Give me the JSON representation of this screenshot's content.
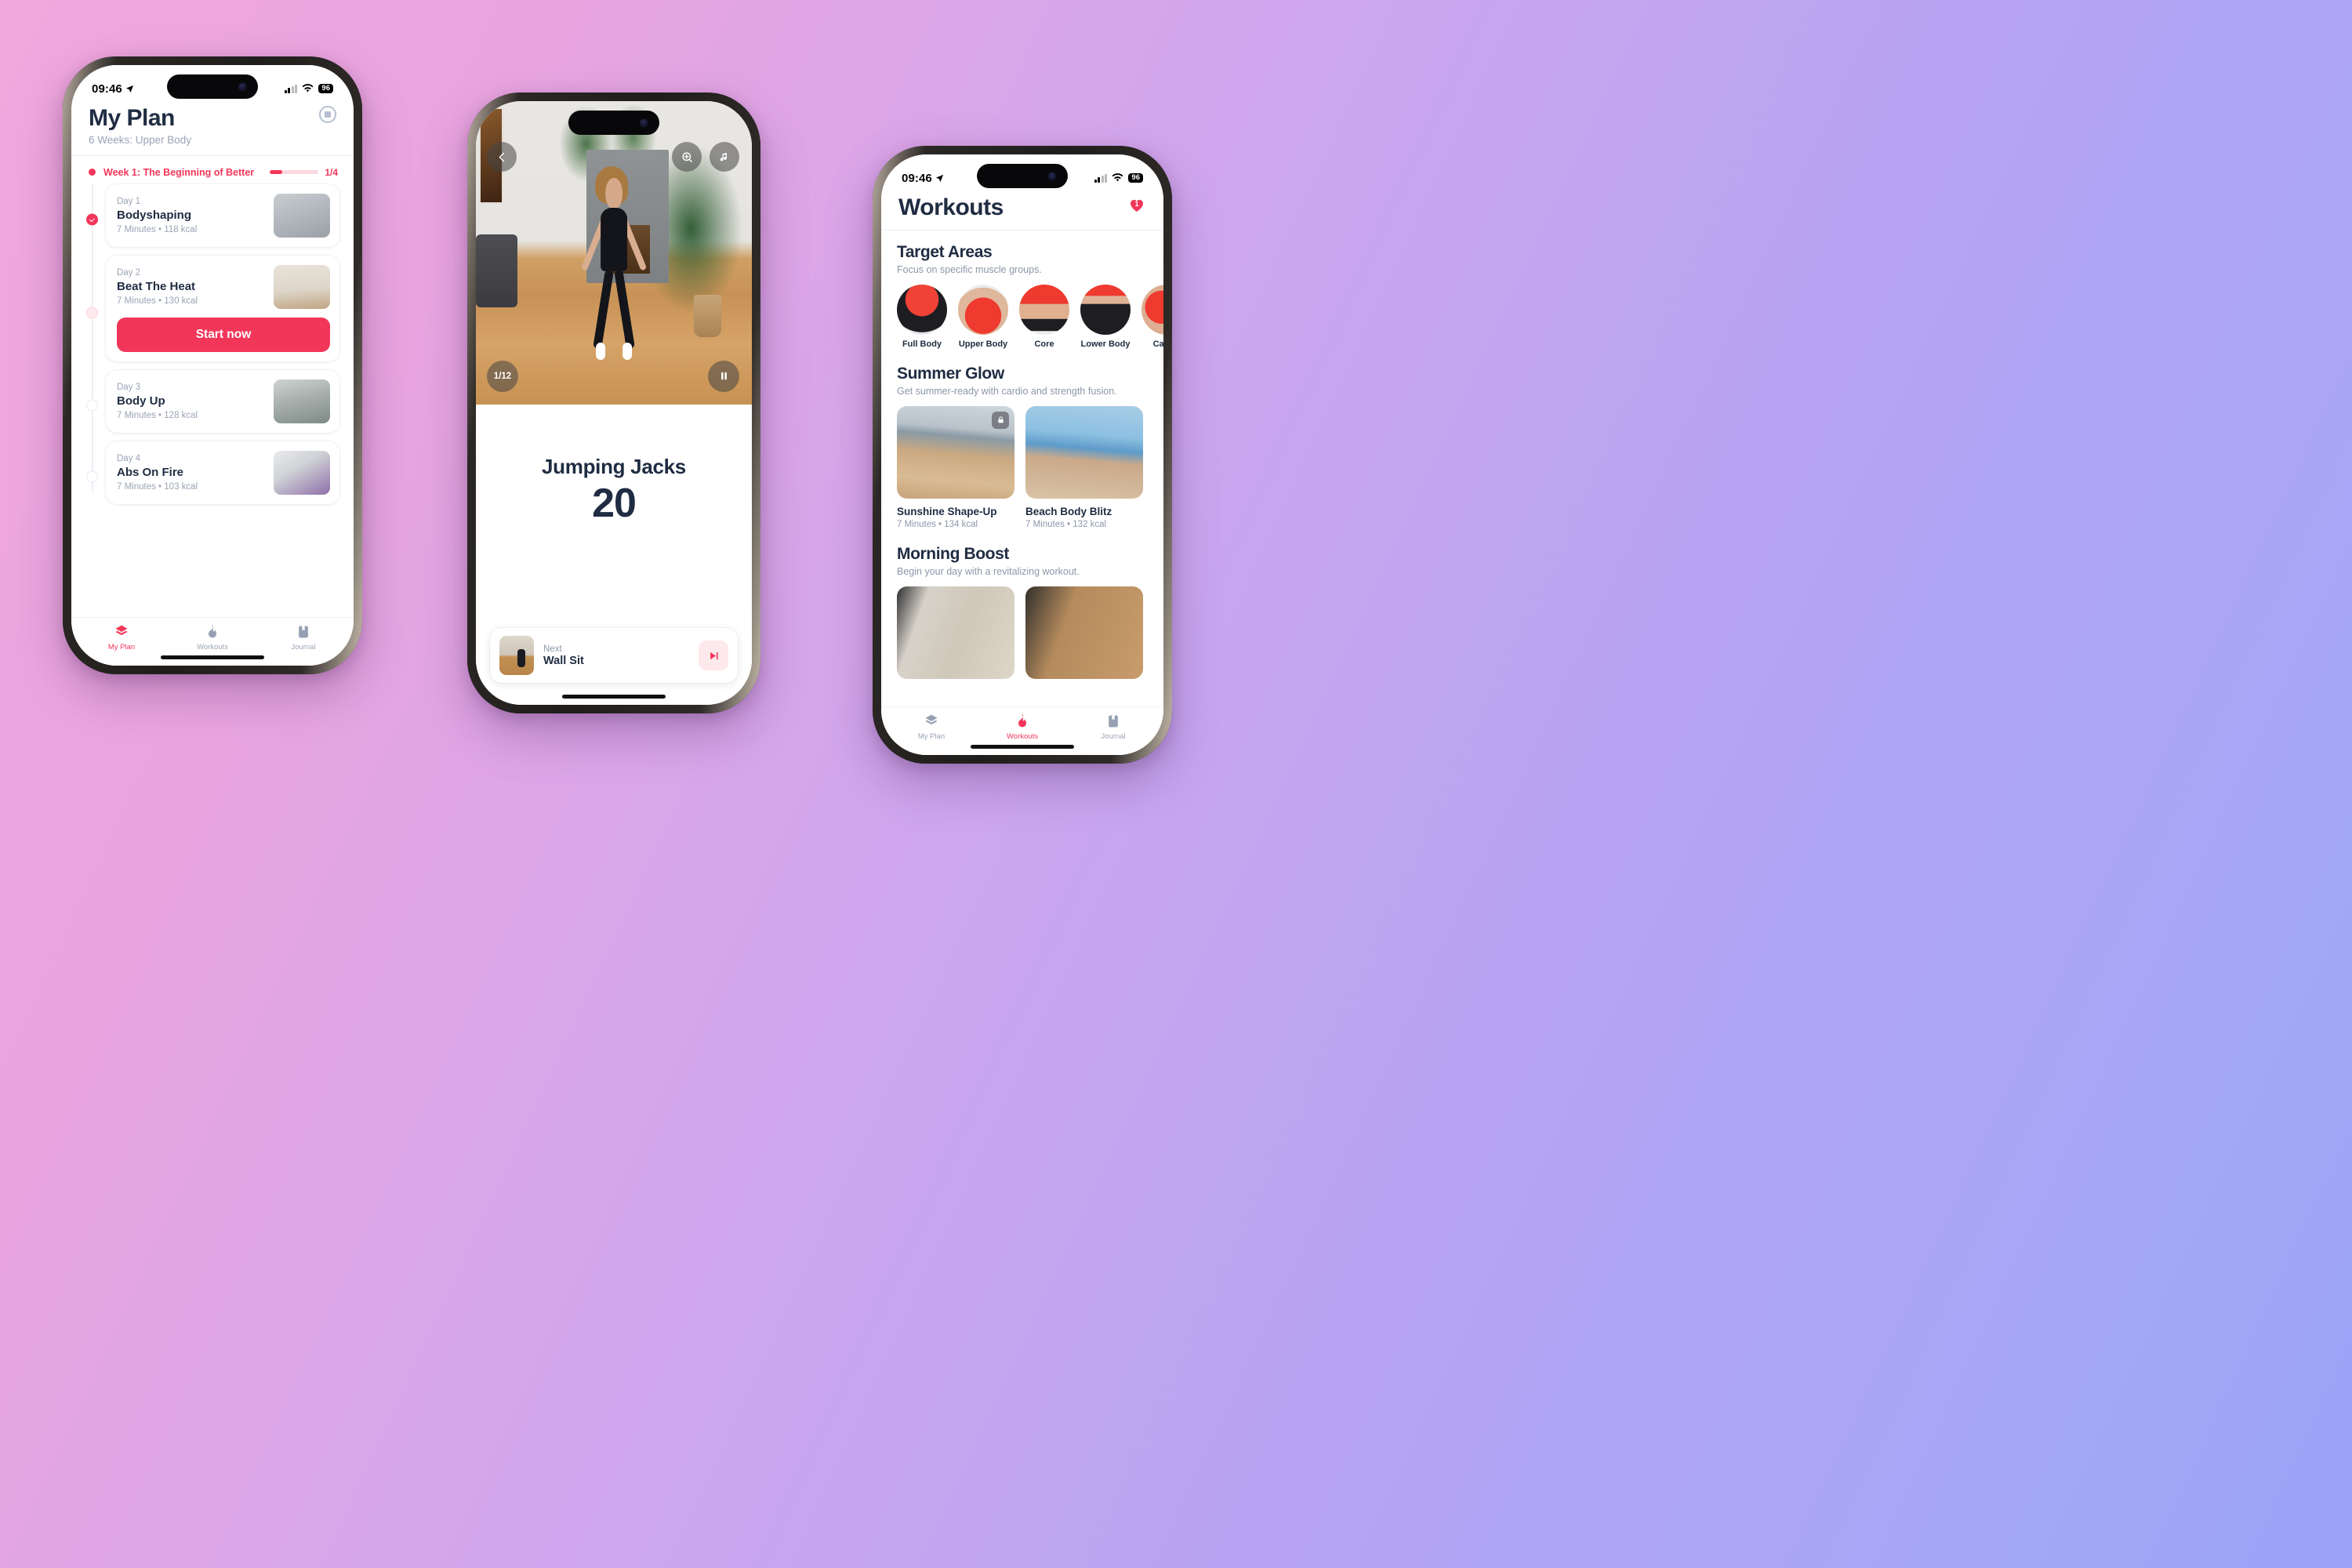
{
  "phone1": {
    "status": {
      "time": "09:46",
      "battery": "96"
    },
    "header": {
      "title": "My Plan",
      "subtitle": "6 Weeks: Upper Body",
      "action_icon": "stop-record-icon"
    },
    "week": {
      "title": "Week 1: The Beginning of Better",
      "count": "1/4",
      "progress_percent": 25
    },
    "days": [
      {
        "day": "Day 1",
        "name": "Bodyshaping",
        "meta": "7 Minutes • 118 kcal",
        "state": "done"
      },
      {
        "day": "Day 2",
        "name": "Beat The Heat",
        "meta": "7 Minutes • 130 kcal",
        "state": "next",
        "cta": "Start now"
      },
      {
        "day": "Day 3",
        "name": "Body Up",
        "meta": "7 Minutes • 128 kcal",
        "state": "locked"
      },
      {
        "day": "Day 4",
        "name": "Abs On Fire",
        "meta": "7 Minutes • 103 kcal",
        "state": "locked"
      }
    ],
    "tabs": [
      {
        "label": "My Plan",
        "icon": "layers-icon",
        "active": true
      },
      {
        "label": "Workouts",
        "icon": "flame-icon",
        "active": false
      },
      {
        "label": "Journal",
        "icon": "bookmark-icon",
        "active": false
      }
    ]
  },
  "phone2": {
    "video": {
      "back_icon": "chevron-left-icon",
      "zoom_icon": "zoom-in-icon",
      "music_icon": "music-note-icon",
      "counter": "1/12",
      "pause_icon": "pause-icon"
    },
    "exercise": {
      "name": "Jumping Jacks",
      "reps": "20"
    },
    "next": {
      "label": "Next",
      "name": "Wall Sit",
      "skip_icon": "skip-forward-icon"
    }
  },
  "phone3": {
    "status": {
      "time": "09:46",
      "battery": "96"
    },
    "header": {
      "title": "Workouts",
      "favorites_badge": "1",
      "favorites_icon": "heart-icon"
    },
    "sections": [
      {
        "title": "Target Areas",
        "subtitle": "Focus on specific muscle groups.",
        "chips": [
          {
            "label": "Full Body"
          },
          {
            "label": "Upper Body"
          },
          {
            "label": "Core"
          },
          {
            "label": "Lower Body"
          },
          {
            "label": "Cardio"
          }
        ]
      },
      {
        "title": "Summer Glow",
        "subtitle": "Get summer-ready with cardio and strength fusion.",
        "cards": [
          {
            "title": "Sunshine Shape-Up",
            "meta": "7 Minutes • 134 kcal",
            "locked": true
          },
          {
            "title": "Beach Body Blitz",
            "meta": "7 Minutes • 132 kcal",
            "locked": false
          }
        ]
      },
      {
        "title": "Morning Boost",
        "subtitle": "Begin your day with a revitalizing workout.",
        "cards": []
      }
    ],
    "tabs": [
      {
        "label": "My Plan",
        "icon": "layers-icon",
        "active": false
      },
      {
        "label": "Workouts",
        "icon": "flame-icon",
        "active": true
      },
      {
        "label": "Journal",
        "icon": "bookmark-icon",
        "active": false
      }
    ]
  },
  "theme": {
    "accent": "#f2365a",
    "text": "#1f2c42",
    "muted": "#9aa4b6"
  }
}
